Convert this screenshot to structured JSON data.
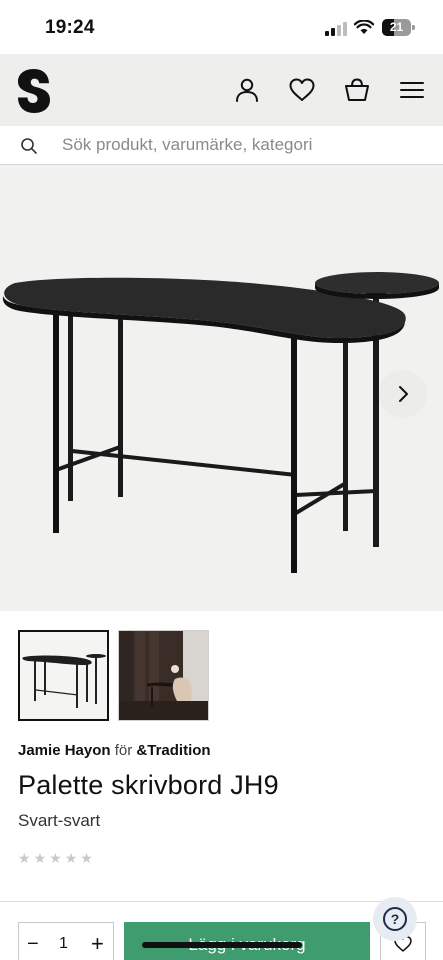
{
  "status_bar": {
    "time": "19:24",
    "battery": "21"
  },
  "header": {
    "logo_icon": "s-brand-logo",
    "icons": [
      "user-icon",
      "heart-icon",
      "bag-icon",
      "menu-icon"
    ]
  },
  "search": {
    "placeholder": "Sök produkt, varumärke, kategori"
  },
  "gallery": {
    "next_icon": "chevron-right-icon",
    "thumbnail_count": 2
  },
  "product": {
    "designer": "Jamie Hayon",
    "connector": "för",
    "brand": "&Tradition",
    "title": "Palette skrivbord JH9",
    "variant": "Svart-svart",
    "rating_stars": 5
  },
  "purchase": {
    "quantity": "1",
    "minus": "−",
    "plus": "+",
    "add_to_cart": "Lägg i varukorg"
  },
  "colors": {
    "header_bg": "#eeeeec",
    "cart_green": "#3e9c6f",
    "help_bg": "#e7ecf3"
  }
}
